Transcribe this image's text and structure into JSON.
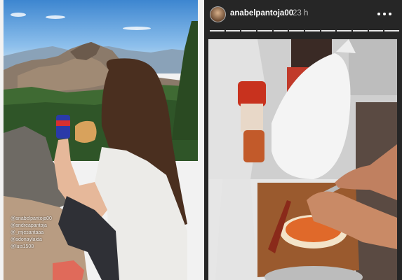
{
  "story": {
    "username": "anabelpantoja00",
    "timestamp": "23 h",
    "more_icon": "more-horizontal-icon",
    "progress": {
      "segments": 12,
      "current": 12
    }
  },
  "left_photo": {
    "tags": [
      "@anabelpantoja00",
      "@andreapantoja",
      "@_mjesantaaa",
      "@adonaylaida",
      "@luis1508"
    ]
  }
}
